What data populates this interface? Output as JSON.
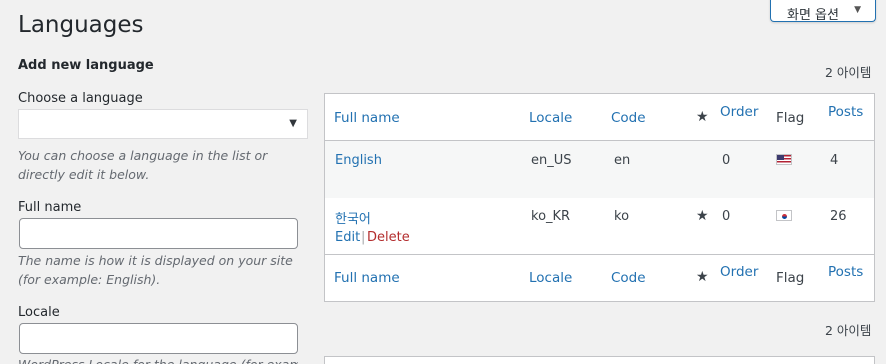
{
  "screen_options": {
    "label": "화면 옵션"
  },
  "page": {
    "title": "Languages"
  },
  "form": {
    "section_title": "Add new language",
    "choose_label": "Choose a language",
    "choose_value": "",
    "choose_help": "You can choose a language in the list or directly edit it below.",
    "fullname_label": "Full name",
    "fullname_value": "",
    "fullname_help": "The name is how it is displayed on your site (for example: English).",
    "locale_label": "Locale",
    "locale_value": "",
    "locale_help": "WordPress Locale for the language (for example:"
  },
  "list": {
    "count_top": "2 아이템",
    "count_bottom": "2 아이템",
    "columns": {
      "full_name": "Full name",
      "locale": "Locale",
      "code": "Code",
      "order": "Order",
      "flag": "Flag",
      "posts": "Posts"
    },
    "rows": [
      {
        "name": "English",
        "locale": "en_US",
        "code": "en",
        "default": false,
        "order": "0",
        "flag": "us-flag",
        "posts": "4"
      },
      {
        "name": "한국어",
        "locale": "ko_KR",
        "code": "ko",
        "default": true,
        "order": "0",
        "flag": "kr-flag",
        "posts": "26",
        "actions": {
          "edit": "Edit",
          "delete": "Delete"
        }
      }
    ]
  }
}
